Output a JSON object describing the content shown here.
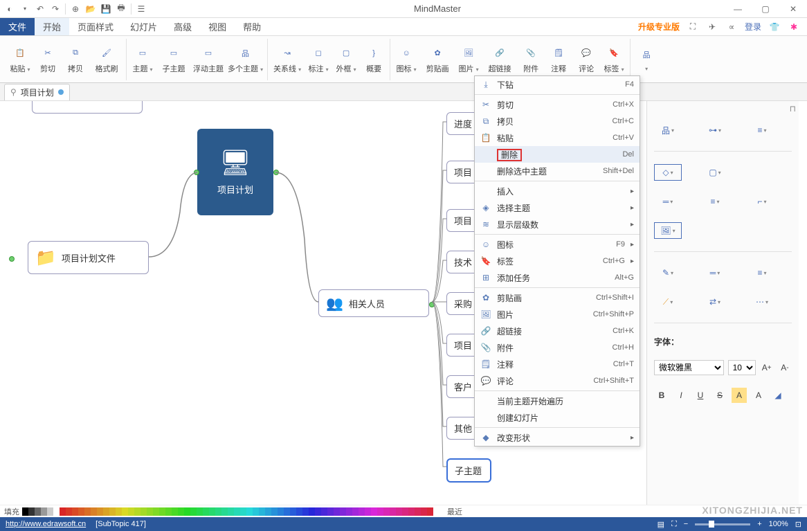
{
  "app": {
    "title": "MindMaster"
  },
  "qat": [
    "globe",
    "dd",
    "undo",
    "redo",
    "sep",
    "new",
    "open",
    "save",
    "print",
    "sep",
    "options"
  ],
  "menubar": {
    "tabs": [
      "文件",
      "开始",
      "页面样式",
      "幻灯片",
      "高级",
      "视图",
      "帮助"
    ],
    "active": 1,
    "right": {
      "upgrade": "升级专业版",
      "login": "登录"
    }
  },
  "ribbon": [
    {
      "items": [
        {
          "icon": "📋",
          "label": "粘贴",
          "dd": true
        },
        {
          "icon": "✂",
          "label": "剪切"
        },
        {
          "icon": "⧉",
          "label": "拷贝"
        },
        {
          "icon": "🖌",
          "label": "格式刷"
        }
      ]
    },
    {
      "items": [
        {
          "icon": "▭",
          "label": "主题",
          "dd": true
        },
        {
          "icon": "▭",
          "label": "子主题"
        },
        {
          "icon": "▭",
          "label": "浮动主题"
        },
        {
          "icon": "品",
          "label": "多个主题",
          "dd": true
        }
      ]
    },
    {
      "items": [
        {
          "icon": "↝",
          "label": "关系线",
          "dd": true
        },
        {
          "icon": "◻",
          "label": "标注",
          "dd": true
        },
        {
          "icon": "▢",
          "label": "外框",
          "dd": true
        },
        {
          "icon": "}",
          "label": "概要"
        }
      ]
    },
    {
      "items": [
        {
          "icon": "☺",
          "label": "图标",
          "dd": true
        },
        {
          "icon": "✿",
          "label": "剪贴画"
        },
        {
          "icon": "🖼",
          "label": "图片",
          "dd": true
        },
        {
          "icon": "🔗",
          "label": "超链接"
        },
        {
          "icon": "📎",
          "label": "附件"
        },
        {
          "icon": "🗒",
          "label": "注释"
        },
        {
          "icon": "💬",
          "label": "评论"
        },
        {
          "icon": "🔖",
          "label": "标签",
          "dd": true
        }
      ]
    },
    {
      "items": [
        {
          "icon": "品",
          "label": "",
          "dd": true
        }
      ]
    }
  ],
  "doctab": {
    "label": "项目计划"
  },
  "nodes": {
    "root": "项目计划文件",
    "main": "项目计划",
    "people": "相关人员",
    "progress": "进度",
    "proj1": "项目",
    "proj2": "项目",
    "tech": "技术",
    "purchase": "采购",
    "proj3": "项目",
    "customer": "客户",
    "other": "其他",
    "sub": "子主题"
  },
  "ctx": [
    {
      "type": "item",
      "icon": "⤓",
      "label": "下钻",
      "shortcut": "F4"
    },
    {
      "type": "sep"
    },
    {
      "type": "item",
      "icon": "✂",
      "label": "剪切",
      "shortcut": "Ctrl+X"
    },
    {
      "type": "item",
      "icon": "⧉",
      "label": "拷贝",
      "shortcut": "Ctrl+C"
    },
    {
      "type": "item",
      "icon": "📋",
      "label": "粘贴",
      "shortcut": "Ctrl+V"
    },
    {
      "type": "item",
      "icon": "",
      "label": "删除",
      "shortcut": "Del",
      "highlight": true
    },
    {
      "type": "item",
      "icon": "",
      "label": "删除选中主题",
      "shortcut": "Shift+Del"
    },
    {
      "type": "sep"
    },
    {
      "type": "item",
      "icon": "",
      "label": "插入",
      "sub": true
    },
    {
      "type": "item",
      "icon": "◈",
      "label": "选择主题",
      "sub": true
    },
    {
      "type": "item",
      "icon": "≋",
      "label": "显示层级数",
      "sub": true
    },
    {
      "type": "sep"
    },
    {
      "type": "item",
      "icon": "☺",
      "label": "图标",
      "shortcut": "F9",
      "sub": true
    },
    {
      "type": "item",
      "icon": "🔖",
      "label": "标签",
      "shortcut": "Ctrl+G",
      "sub": true
    },
    {
      "type": "item",
      "icon": "⊞",
      "label": "添加任务",
      "shortcut": "Alt+G"
    },
    {
      "type": "sep"
    },
    {
      "type": "item",
      "icon": "✿",
      "label": "剪贴画",
      "shortcut": "Ctrl+Shift+I"
    },
    {
      "type": "item",
      "icon": "🖼",
      "label": "图片",
      "shortcut": "Ctrl+Shift+P"
    },
    {
      "type": "item",
      "icon": "🔗",
      "label": "超链接",
      "shortcut": "Ctrl+K"
    },
    {
      "type": "item",
      "icon": "📎",
      "label": "附件",
      "shortcut": "Ctrl+H"
    },
    {
      "type": "item",
      "icon": "🗒",
      "label": "注释",
      "shortcut": "Ctrl+T"
    },
    {
      "type": "item",
      "icon": "💬",
      "label": "评论",
      "shortcut": "Ctrl+Shift+T"
    },
    {
      "type": "sep"
    },
    {
      "type": "item",
      "icon": "",
      "label": "当前主题开始遍历"
    },
    {
      "type": "item",
      "icon": "",
      "label": "创建幻灯片"
    },
    {
      "type": "sep"
    },
    {
      "type": "item",
      "icon": "◆",
      "label": "改变形状",
      "sub": true
    }
  ],
  "rpanel": {
    "font_label": "字体：",
    "font_name": "微软雅黑",
    "font_size": "10"
  },
  "palette": {
    "label": "填充",
    "recent": "最近"
  },
  "status": {
    "url": "http://www.edrawsoft.cn",
    "info": "[SubTopic 417]",
    "zoom": "100%"
  },
  "watermark": "XITONGZHIJIA.NET"
}
